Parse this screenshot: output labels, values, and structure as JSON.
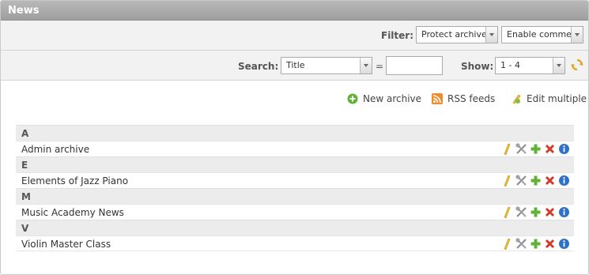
{
  "window": {
    "title": "News"
  },
  "filter": {
    "label": "Filter:",
    "protect": "Protect archive",
    "comments": "Enable comment"
  },
  "search": {
    "label": "Search:",
    "field": "Title",
    "equals": "=",
    "value": "",
    "show_label": "Show:",
    "show_value": "1 - 4"
  },
  "actions": {
    "new_archive": "New archive",
    "rss_feeds": "RSS feeds",
    "edit_multiple": "Edit multiple"
  },
  "groups": [
    {
      "letter": "A",
      "item": "Admin archive"
    },
    {
      "letter": "E",
      "item": "Elements of Jazz Piano"
    },
    {
      "letter": "M",
      "item": "Music Academy News"
    },
    {
      "letter": "V",
      "item": "Violin Master Class"
    }
  ],
  "row_icons": [
    "edit-icon",
    "settings-icon",
    "add-icon",
    "delete-icon",
    "info-icon"
  ]
}
